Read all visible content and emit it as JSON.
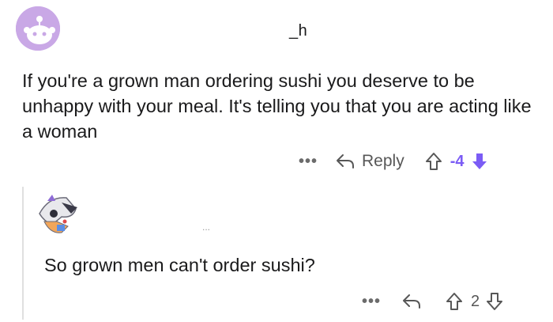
{
  "comment": {
    "username": "_h",
    "body": "If you're a grown man ordering sushi you deserve to be unhappy with your meal. It's telling you that you are acting like a woman",
    "more_label": "•••",
    "reply_label": "Reply",
    "score": "-4",
    "downvote_color": "#7b5cf5"
  },
  "reply": {
    "username": "...",
    "body": "So grown men can't order sushi?",
    "more_label": "•••",
    "score": "2"
  }
}
